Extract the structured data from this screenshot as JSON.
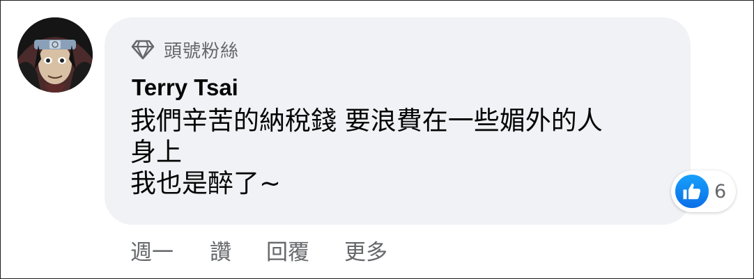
{
  "badge": {
    "label": "頭號粉絲",
    "icon": "diamond-icon"
  },
  "comment": {
    "author": "Terry Tsai",
    "lines": [
      "我們辛苦的納稅錢 要浪費在一些媚外的人",
      "身上",
      "我也是醉了~"
    ]
  },
  "reactions": {
    "icon": "like-icon",
    "count": "6"
  },
  "actions": {
    "timestamp": "週一",
    "like": "讚",
    "reply": "回覆",
    "more": "更多"
  },
  "colors": {
    "bubble": "#f0f2f5",
    "secondary_text": "#65676b",
    "primary_text": "#050505",
    "like_blue": "#0b6ee8"
  }
}
